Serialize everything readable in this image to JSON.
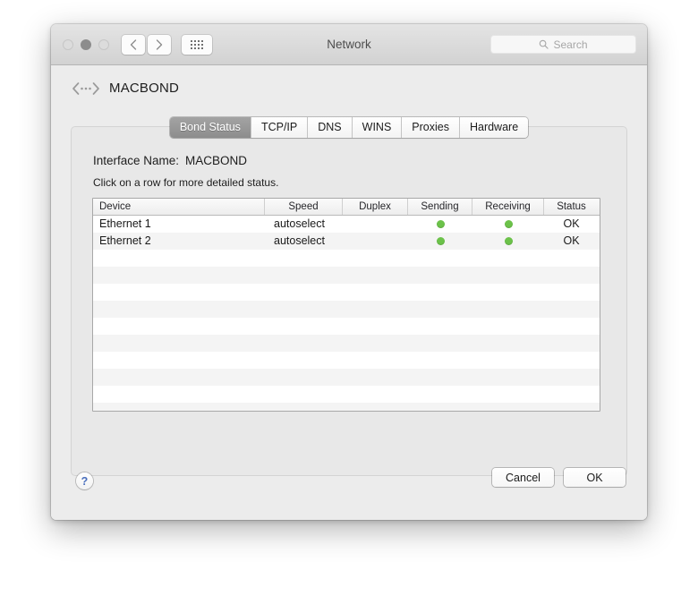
{
  "window": {
    "title": "Network",
    "traffic_lights": [
      "close",
      "minimize",
      "zoom"
    ],
    "nav": {
      "back_icon": "chevron-left-icon",
      "forward_icon": "chevron-right-icon",
      "grid_icon": "show-all-grid-icon"
    },
    "search": {
      "placeholder": "Search",
      "icon": "search-icon"
    }
  },
  "interface": {
    "icon": "network-bond-icon",
    "title": "MACBOND"
  },
  "tabs": [
    {
      "label": "Bond Status",
      "selected": true
    },
    {
      "label": "TCP/IP",
      "selected": false
    },
    {
      "label": "DNS",
      "selected": false
    },
    {
      "label": "WINS",
      "selected": false
    },
    {
      "label": "Proxies",
      "selected": false
    },
    {
      "label": "Hardware",
      "selected": false
    }
  ],
  "panel": {
    "interface_name_label": "Interface Name:",
    "interface_name_value": "MACBOND",
    "hint": "Click on a row for more detailed status."
  },
  "table": {
    "columns": [
      "Device",
      "Speed",
      "Duplex",
      "Sending",
      "Receiving",
      "Status"
    ],
    "rows": [
      {
        "device": "Ethernet 1",
        "speed": "autoselect",
        "duplex": "",
        "sending": "active",
        "receiving": "active",
        "status": "OK"
      },
      {
        "device": "Ethernet 2",
        "speed": "autoselect",
        "duplex": "",
        "sending": "active",
        "receiving": "active",
        "status": "OK"
      }
    ],
    "empty_row_count": 10,
    "indicator_color": "#6cc24a"
  },
  "footer": {
    "help_label": "?",
    "cancel_label": "Cancel",
    "ok_label": "OK"
  }
}
